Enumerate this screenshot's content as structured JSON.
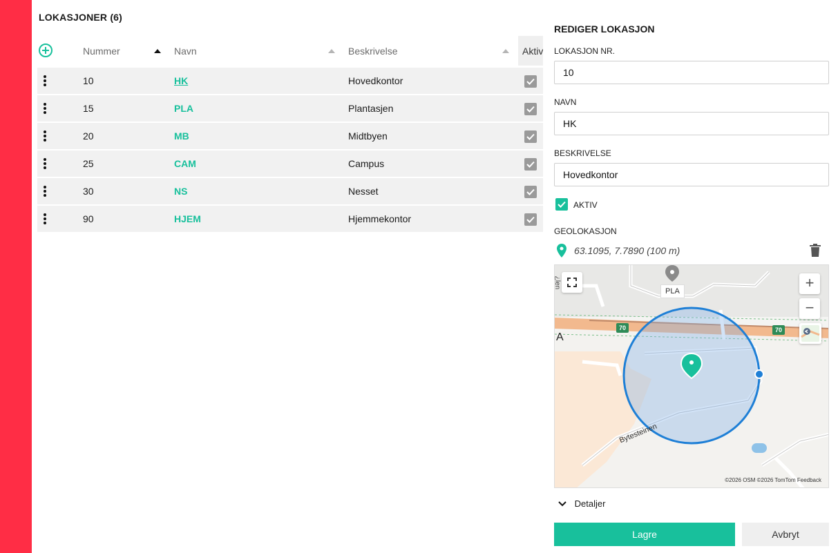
{
  "list": {
    "title": "LOKASJONER (6)",
    "columns": {
      "number": "Nummer",
      "name": "Navn",
      "description": "Beskrivelse",
      "active": "Aktiv"
    },
    "rows": [
      {
        "number": "10",
        "name": "HK",
        "description": "Hovedkontor",
        "active": true
      },
      {
        "number": "15",
        "name": "PLA",
        "description": "Plantasjen",
        "active": true
      },
      {
        "number": "20",
        "name": "MB",
        "description": "Midtbyen",
        "active": true
      },
      {
        "number": "25",
        "name": "CAM",
        "description": "Campus",
        "active": true
      },
      {
        "number": "30",
        "name": "NS",
        "description": "Nesset",
        "active": true
      },
      {
        "number": "90",
        "name": "HJEM",
        "description": "Hjemmekontor",
        "active": true
      }
    ]
  },
  "editor": {
    "title": "REDIGER LOKASJON",
    "number_label": "LOKASJON NR.",
    "number_value": "10",
    "name_label": "NAVN",
    "name_value": "HK",
    "description_label": "BESKRIVELSE",
    "description_value": "Hovedkontor",
    "active_label": "AKTIV",
    "geo_label": "GEOLOKASJON",
    "geo_value": "63.1095, 7.7890 (100 m)",
    "details_label": "Detaljer",
    "save_label": "Lagre",
    "cancel_label": "Avbryt"
  },
  "map": {
    "marker_label": "PLA",
    "road_shield": "70",
    "street_name": "Bytesteinen",
    "edge_letter": "A",
    "partial_label": "¿len",
    "copyright": "©2026 OSM  ©2026 TomTom  Feedback"
  },
  "colors": {
    "accent": "#18c09c",
    "brand_red": "#ff2d45",
    "circle": "#1e7fd6"
  }
}
